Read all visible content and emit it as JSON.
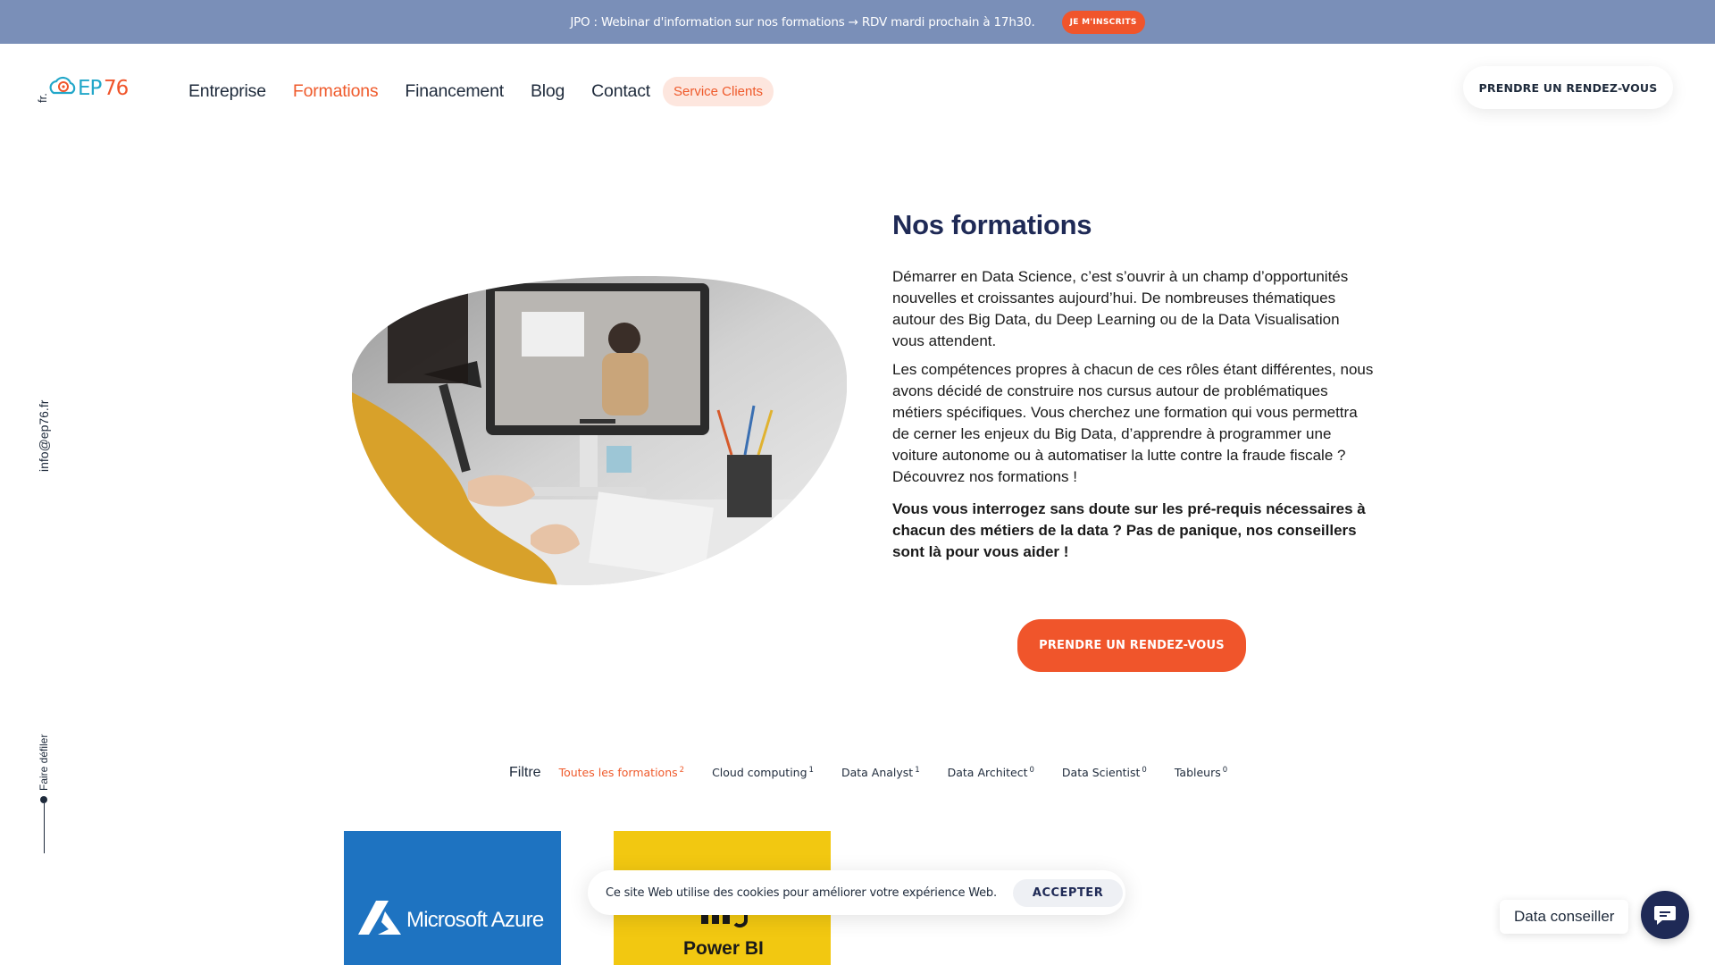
{
  "announcement": {
    "text": "JPO : Webinar d'information sur nos formations → RDV mardi prochain à 17h30.",
    "button_label": "JE M'INSCRITS"
  },
  "header": {
    "logo_text": "EP76",
    "lang": "fr.",
    "nav": [
      {
        "label": "Entreprise",
        "active": false
      },
      {
        "label": "Formations",
        "active": true
      },
      {
        "label": "Financement",
        "active": false
      },
      {
        "label": "Blog",
        "active": false
      },
      {
        "label": "Contact",
        "active": false
      }
    ],
    "service_label": "Service Clients",
    "cta_label": "PRENDRE UN RENDEZ-VOUS"
  },
  "side": {
    "email": "info@ep76.fr",
    "scroll_label": "Faire défiler"
  },
  "hero": {
    "title": "Nos formations",
    "p1": "Démarrer en Data Science, c’est s’ouvrir à un champ d’opportunités nouvelles et croissantes aujourd’hui. De nombreuses thématiques autour des Big Data, du Deep Learning ou de la Data Visualisation vous attendent.",
    "p2": "Les compétences propres à chacun de ces rôles étant différentes, nous avons décidé de construire nos cursus autour de problématiques métiers spécifiques. Vous cherchez une formation qui vous permettra de cerner les enjeux du Big Data, d’apprendre à programmer une voiture autonome ou à automatiser la lutte contre la fraude fiscale ? Découvrez nos formations !",
    "p3": "Vous vous interrogez sans doute sur les pré-requis nécessaires à chacun des métiers de la data ? Pas de panique, nos conseillers sont là pour vous aider !",
    "cta_label": "PRENDRE UN RENDEZ-VOUS"
  },
  "filters": {
    "label": "Filtre",
    "items": [
      {
        "label": "Toutes les formations",
        "count": "2"
      },
      {
        "label": "Cloud computing",
        "count": "1"
      },
      {
        "label": "Data Analyst",
        "count": "1"
      },
      {
        "label": "Data Architect",
        "count": "0"
      },
      {
        "label": "Data Scientist",
        "count": "0"
      },
      {
        "label": "Tableurs",
        "count": "0"
      }
    ]
  },
  "cards": [
    {
      "brand": "Microsoft Azure",
      "color": "#1e73c1"
    },
    {
      "brand": "Power BI",
      "color": "#f2c811"
    }
  ],
  "cookie": {
    "text": "Ce site Web utilise des cookies pour améliorer votre expérience Web.",
    "button_label": "ACCEPTER"
  },
  "chat": {
    "label": "Data conseiller"
  },
  "colors": {
    "accent": "#f0552b",
    "navy": "#1f2a56",
    "topbar": "#7a8fb8"
  }
}
